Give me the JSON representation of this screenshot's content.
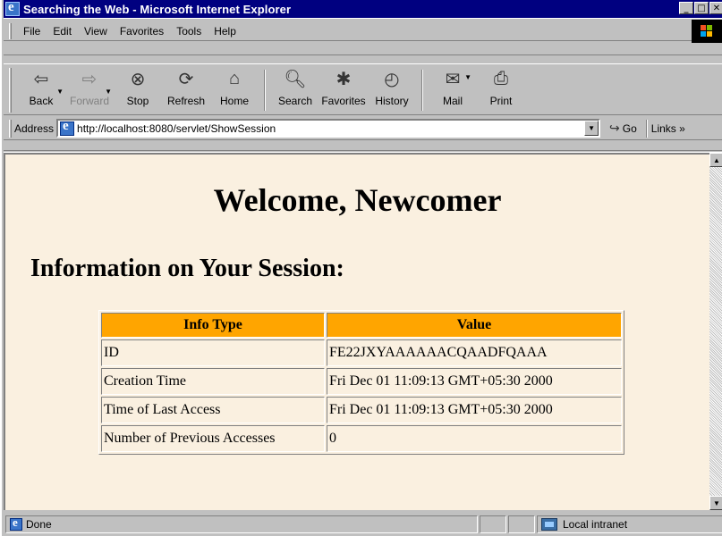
{
  "window": {
    "title": "Searching the Web - Microsoft Internet Explorer"
  },
  "menu": {
    "items": [
      "File",
      "Edit",
      "View",
      "Favorites",
      "Tools",
      "Help"
    ]
  },
  "toolbar": {
    "buttons": [
      {
        "label": "Back",
        "icon": "back-arrow-icon",
        "enabled": true
      },
      {
        "label": "Forward",
        "icon": "forward-arrow-icon",
        "enabled": false
      },
      {
        "label": "Stop",
        "icon": "stop-icon",
        "enabled": true
      },
      {
        "label": "Refresh",
        "icon": "refresh-icon",
        "enabled": true
      },
      {
        "label": "Home",
        "icon": "home-icon",
        "enabled": true
      },
      {
        "label": "Search",
        "icon": "search-icon",
        "enabled": true
      },
      {
        "label": "Favorites",
        "icon": "favorites-icon",
        "enabled": true
      },
      {
        "label": "History",
        "icon": "history-icon",
        "enabled": true
      },
      {
        "label": "Mail",
        "icon": "mail-icon",
        "enabled": true
      },
      {
        "label": "Print",
        "icon": "print-icon",
        "enabled": true
      }
    ]
  },
  "address": {
    "label": "Address",
    "url": "http://localhost:8080/servlet/ShowSession",
    "go_label": "Go",
    "links_label": "Links"
  },
  "page": {
    "heading": "Welcome, Newcomer",
    "subheading": "Information on Your Session:",
    "table": {
      "headers": [
        "Info Type",
        "Value"
      ],
      "rows": [
        [
          "ID",
          "FE22JXYAAAAAACQAADFQAAA"
        ],
        [
          "Creation Time",
          "Fri Dec 01 11:09:13 GMT+05:30 2000"
        ],
        [
          "Time of Last Access",
          "Fri Dec 01 11:09:13 GMT+05:30 2000"
        ],
        [
          "Number of Previous Accesses",
          "0"
        ]
      ]
    },
    "background_color": "#faf0e0",
    "header_color": "#ffa500"
  },
  "status": {
    "text": "Done",
    "zone": "Local intranet"
  }
}
